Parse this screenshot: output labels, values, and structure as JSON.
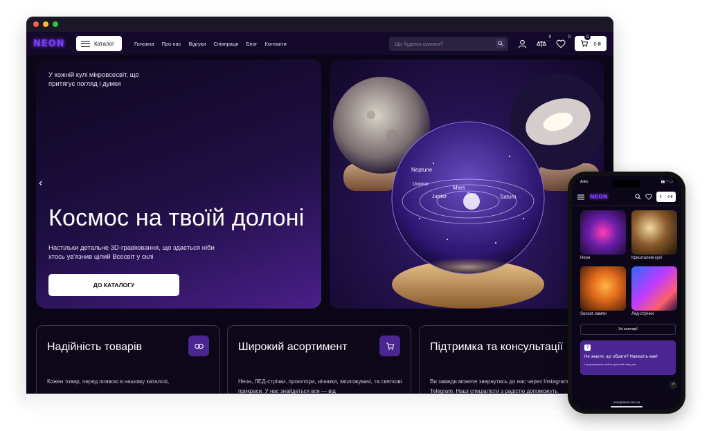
{
  "desktop": {
    "header": {
      "logo": "NEON",
      "catalog_label": "Каталог",
      "nav": [
        "Головна",
        "Про нас",
        "Відгуки",
        "Співпраця",
        "Блог",
        "Контакти"
      ],
      "search_placeholder": "Що будемо шукати?",
      "compare_count": "0",
      "wishlist_count": "0",
      "cart_count": "0",
      "cart_total": "0 ₴"
    },
    "hero": {
      "tagline": "У кожній кулі мікровсесвіт, що притягує погляд і думки",
      "title": "Космос на твоїй долоні",
      "subtitle": "Настільки детальне 3D-гравіювання, що здається ніби хтось ув'язнив цілий Всесвіт у склі",
      "cta": "ДО КАТАЛОГУ",
      "image_labels": [
        "Neptune",
        "Uranus",
        "Jupiter",
        "Mars",
        "Sun",
        "Saturn"
      ]
    },
    "features": [
      {
        "title": "Надійність товарів",
        "text": "Кожен товар, перед появою в нашому каталозі,",
        "icon": "link-icon"
      },
      {
        "title": "Широкий асортимент",
        "text": "Неон, ЛЕД-стрічки, проєктори, нічники, зволожувачі, та святкові прикраси. У нас знайдеться все — від",
        "icon": "cart-icon"
      },
      {
        "title": "Підтримка та консультації",
        "text": "Ви завжди можете звернутись до нас через Instagram або Telegram. Наші спеціалісти з радістю допоможуть",
        "icon": "chat-icon"
      }
    ]
  },
  "mobile": {
    "status_carrier": "Ariko",
    "logo": "NEON",
    "cart_count": "0",
    "wishlist_count": "0",
    "cart_total": "0 ₴",
    "categories": [
      "Неон",
      "Кришталеві кулі",
      "Sunset лампи",
      "Лед-стрічки"
    ],
    "all_categories": "Усі категорії",
    "help_title": "Не знаєте, що обрати? Напишіть нам!",
    "help_text": "І ми допоможемо знайти ідеальний товар для",
    "url": "neonplanet.com.ua"
  },
  "colors": {
    "accent": "#7a3cff",
    "panel": "#4b2591",
    "background": "#0b0617"
  }
}
